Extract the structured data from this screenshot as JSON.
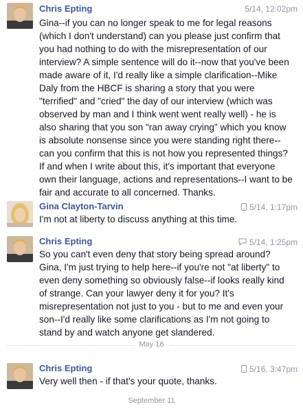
{
  "messages": [
    {
      "sender": "Chris Epting",
      "timestamp": "5/14, 12:02pm",
      "meta_icon": "",
      "text": "Gina--if you can no longer speak to me for legal reasons (which I don't understand) can you please just confirm that you had nothing to do with the misrepresentation of our interview? A simple sentence will do it--now that you've been made aware of it, I'd really like a simple clarification--Mike Daly from the HBCF is sharing a story that you were \"terrified\" and \"cried\" the day of our interview (which was observed by man and I think went went really well) - he is also sharing that you son \"ran away crying\" which you know is absolute nonsense since you were standing right there--can you confirm that this is not how you represented things? If and when I write about this,  it's important that everyone own their language, actions and representations--I want to be fair and accurate to all concerned. Thanks."
    },
    {
      "sender": "Gina Clayton-Tarvin",
      "timestamp": "5/14, 1:17pm",
      "meta_icon": "mobile-icon",
      "text": "I'm not at liberty to discuss anything at this time."
    },
    {
      "sender": "Chris Epting",
      "timestamp": "5/14, 1:25pm",
      "meta_icon": "chat-bubble-icon",
      "text": "So you can't even deny that story being spread around? Gina, I'm just trying to help here--if you're not \"at liberty\" to even deny something so obviously false--if looks really kind of strange. Can your lawyer deny it for you? It's misrepresentation not just to you - but to me and even your son--I'd really like some clarifications as I'm not going to stand by and watch anyone get slandered."
    },
    {
      "sender": "Chris Epting",
      "timestamp": "5/16, 3:47pm",
      "meta_icon": "mobile-icon",
      "text": "Very well then - if that's your quote, thanks."
    }
  ],
  "separators": {
    "may16": "May 16",
    "sept11": "September 11"
  },
  "colors": {
    "name": "#3b5998",
    "meta": "#9197a3",
    "text": "#141823",
    "divider": "#e5e5e5"
  }
}
